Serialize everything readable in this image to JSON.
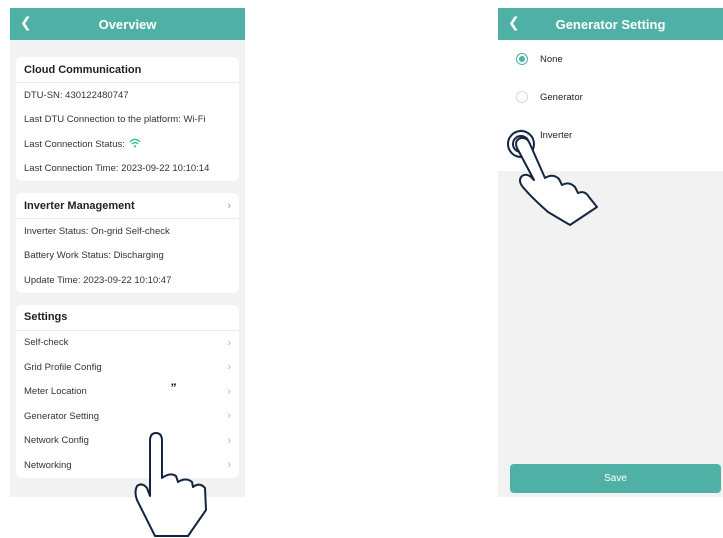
{
  "overview": {
    "title": "Overview",
    "back_icon": "chevron-left-icon",
    "cloud": {
      "title": "Cloud Communication",
      "dtu_sn": "DTU-SN:  430122480747",
      "last_dtu_connection": "Last DTU Connection to the platform:  Wi-Fi",
      "last_status_label": "Last Connection Status:",
      "wifi_icon": "wifi-icon",
      "last_time": "Last Connection Time:  2023-09-22 10:10:14"
    },
    "inverter": {
      "title": "Inverter Management",
      "status": "Inverter Status:  On-grid Self-check",
      "battery": "Battery Work Status:  Discharging",
      "update": "Update Time:  2023-09-22 10:10:47"
    },
    "settings": {
      "title": "Settings",
      "items": [
        "Self-check",
        "Grid Profile Config",
        "Meter Location",
        "Generator Setting",
        "Network Config",
        "Networking"
      ]
    },
    "tap_mark": "”"
  },
  "generator": {
    "title": "Generator Setting",
    "options": [
      "None",
      "Generator",
      "Inverter"
    ],
    "selected": "None",
    "save_label": "Save"
  },
  "colors": {
    "accent": "#4fb0a5",
    "background": "#f2f2f2",
    "wifi": "#2ec27e"
  }
}
